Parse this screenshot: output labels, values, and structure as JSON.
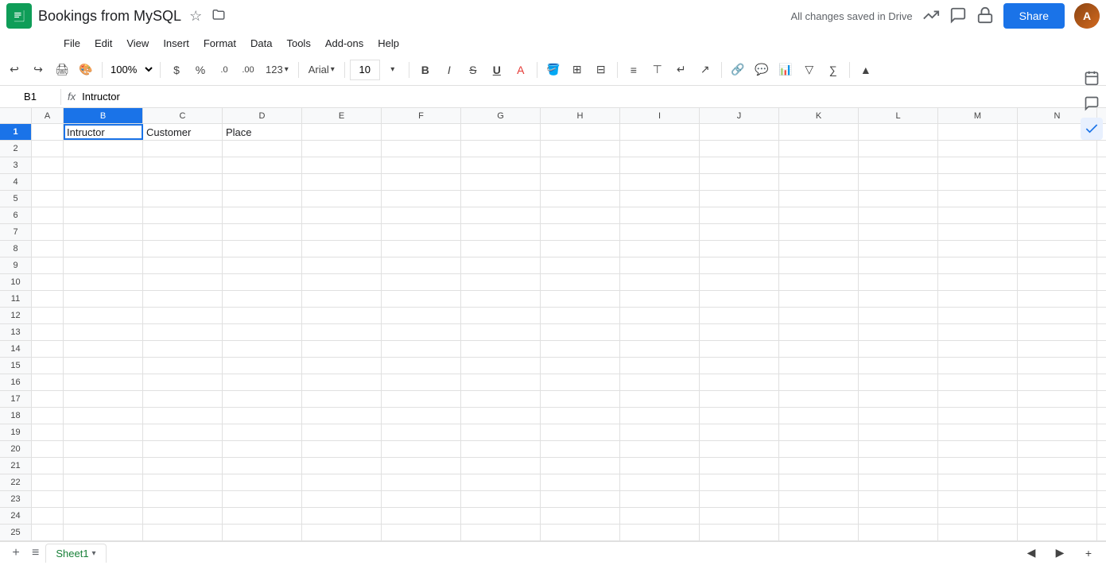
{
  "app": {
    "icon_color": "#0f9d58",
    "title": "Bookings from MySQL",
    "star_symbol": "☆",
    "folder_symbol": "📁"
  },
  "header": {
    "saved_status": "All changes saved in Drive"
  },
  "share_button": {
    "label": "Share"
  },
  "menu": {
    "items": [
      "File",
      "Edit",
      "View",
      "Insert",
      "Format",
      "Data",
      "Tools",
      "Add-ons",
      "Help"
    ]
  },
  "toolbar": {
    "zoom": "100%",
    "currency_symbol": "$",
    "percent_symbol": "%",
    "decimal_decrease": ".0",
    "decimal_increase": ".00",
    "font_name": "Arial",
    "font_size": "10",
    "bold": "B",
    "italic": "I",
    "strikethrough": "S",
    "underline": "U",
    "format_label": "123"
  },
  "formula_bar": {
    "cell_ref": "B1",
    "fx_label": "fx",
    "formula_value": "Intructor"
  },
  "columns": [
    "A",
    "B",
    "C",
    "D",
    "E",
    "F",
    "G",
    "H",
    "I",
    "J",
    "K",
    "L",
    "M",
    "N"
  ],
  "selected_col": "B",
  "rows": [
    {
      "num": 1,
      "cells": {
        "B": "Intructor",
        "C": "Customer",
        "D": "Place"
      }
    },
    {
      "num": 2,
      "cells": {}
    },
    {
      "num": 3,
      "cells": {}
    },
    {
      "num": 4,
      "cells": {}
    },
    {
      "num": 5,
      "cells": {}
    },
    {
      "num": 6,
      "cells": {}
    },
    {
      "num": 7,
      "cells": {}
    },
    {
      "num": 8,
      "cells": {}
    },
    {
      "num": 9,
      "cells": {}
    },
    {
      "num": 10,
      "cells": {}
    },
    {
      "num": 11,
      "cells": {}
    },
    {
      "num": 12,
      "cells": {}
    },
    {
      "num": 13,
      "cells": {}
    },
    {
      "num": 14,
      "cells": {}
    },
    {
      "num": 15,
      "cells": {}
    },
    {
      "num": 16,
      "cells": {}
    },
    {
      "num": 17,
      "cells": {}
    },
    {
      "num": 18,
      "cells": {}
    },
    {
      "num": 19,
      "cells": {}
    },
    {
      "num": 20,
      "cells": {}
    },
    {
      "num": 21,
      "cells": {}
    },
    {
      "num": 22,
      "cells": {}
    },
    {
      "num": 23,
      "cells": {}
    },
    {
      "num": 24,
      "cells": {}
    },
    {
      "num": 25,
      "cells": {}
    }
  ],
  "bottom_bar": {
    "sheet_name": "Sheet1",
    "add_sheet_symbol": "+",
    "sheet_list_symbol": "≡"
  },
  "right_sidebar": {
    "calendar_symbol": "📅",
    "comment_symbol": "💬",
    "check_symbol": "✓"
  }
}
